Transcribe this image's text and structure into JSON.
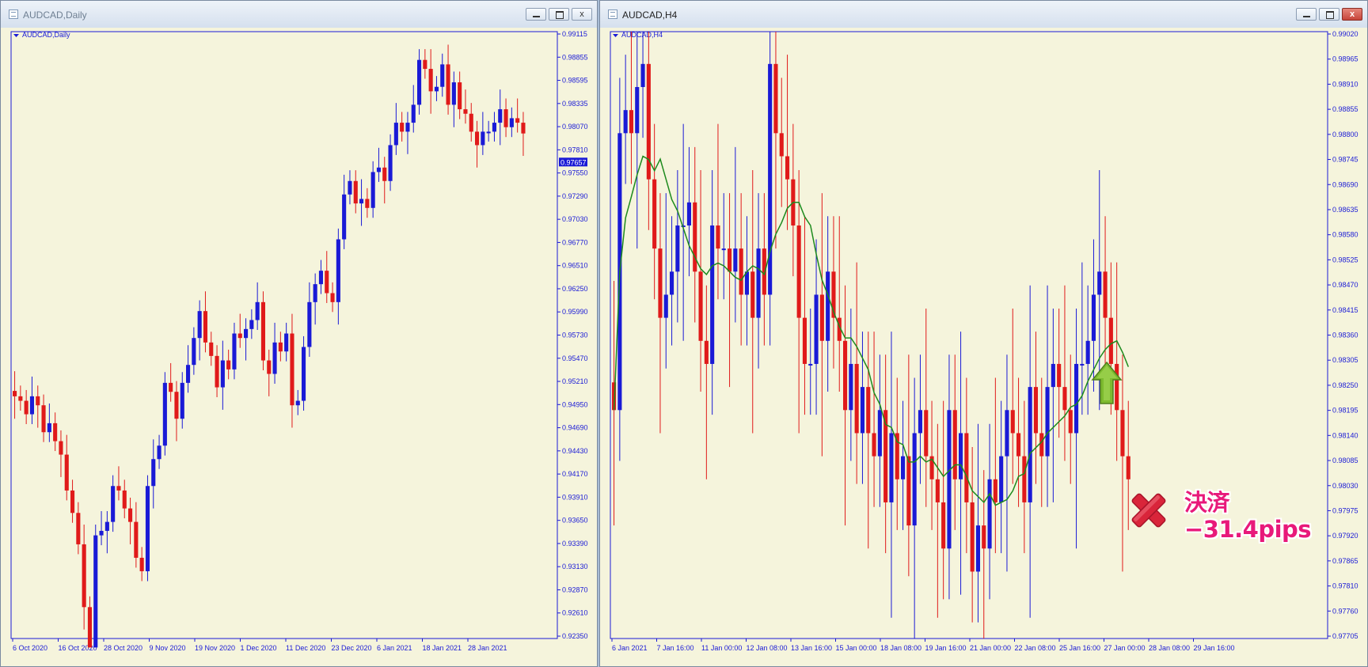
{
  "windows": [
    {
      "title": "AUDCAD,Daily",
      "label": "AUDCAD,Daily",
      "price_marker": "0.97657",
      "ylim": [
        0.9235,
        0.99115
      ],
      "y_ticks": [
        "0.99115",
        "0.98855",
        "0.98595",
        "0.98335",
        "0.98070",
        "0.97810",
        "0.97550",
        "0.97290",
        "0.97030",
        "0.96770",
        "0.96510",
        "0.96250",
        "0.95990",
        "0.95730",
        "0.95470",
        "0.95210",
        "0.94950",
        "0.94690",
        "0.94430",
        "0.94170",
        "0.93910",
        "0.93650",
        "0.93390",
        "0.93130",
        "0.92870",
        "0.92610",
        "0.92350"
      ],
      "x_ticks": [
        "6 Oct 2020",
        "16 Oct 2020",
        "28 Oct 2020",
        "9 Nov 2020",
        "19 Nov 2020",
        "1 Dec 2020",
        "11 Dec 2020",
        "23 Dec 2020",
        "6 Jan 2021",
        "18 Jan 2021",
        "28 Jan 2021"
      ],
      "close_button": "x"
    },
    {
      "title": "AUDCAD,H4",
      "label": "AUDCAD,H4",
      "ylim": [
        0.97705,
        0.9902
      ],
      "y_ticks": [
        "0.99020",
        "0.98965",
        "0.98910",
        "0.98855",
        "0.98800",
        "0.98745",
        "0.98690",
        "0.98635",
        "0.98580",
        "0.98525",
        "0.98470",
        "0.98415",
        "0.98360",
        "0.98305",
        "0.98250",
        "0.98195",
        "0.98140",
        "0.98085",
        "0.98030",
        "0.97975",
        "0.97920",
        "0.97865",
        "0.97810",
        "0.97760",
        "0.97705"
      ],
      "x_ticks": [
        "6 Jan 2021",
        "7 Jan 16:00",
        "11 Jan 00:00",
        "12 Jan 08:00",
        "13 Jan 16:00",
        "15 Jan 00:00",
        "18 Jan 08:00",
        "19 Jan 16:00",
        "21 Jan 00:00",
        "22 Jan 08:00",
        "25 Jan 16:00",
        "27 Jan 00:00",
        "28 Jan 08:00",
        "29 Jan 16:00"
      ],
      "close_button": "x"
    }
  ],
  "chart_data": [
    {
      "type": "candlestick",
      "title": "AUDCAD,Daily",
      "colors": {
        "bull": "#1a1ad6",
        "bear": "#e01a1a",
        "background": "#f5f4dc",
        "axis": "#1a1ad6"
      },
      "close": [
        0.9505,
        0.95,
        0.9485,
        0.9505,
        0.9495,
        0.9465,
        0.9475,
        0.9455,
        0.944,
        0.94,
        0.9375,
        0.934,
        0.927,
        0.9225,
        0.935,
        0.9355,
        0.9365,
        0.9405,
        0.94,
        0.938,
        0.9365,
        0.9325,
        0.931,
        0.9405,
        0.9435,
        0.945,
        0.952,
        0.951,
        0.948,
        0.952,
        0.954,
        0.957,
        0.96,
        0.9565,
        0.955,
        0.9515,
        0.9545,
        0.9535,
        0.9575,
        0.957,
        0.958,
        0.959,
        0.961,
        0.9545,
        0.953,
        0.9565,
        0.9555,
        0.9575,
        0.9495,
        0.95,
        0.956,
        0.961,
        0.963,
        0.9645,
        0.962,
        0.961,
        0.968,
        0.973,
        0.9745,
        0.972,
        0.9725,
        0.9715,
        0.9755,
        0.976,
        0.9745,
        0.9785,
        0.981,
        0.98,
        0.981,
        0.983,
        0.988,
        0.987,
        0.9845,
        0.985,
        0.9875,
        0.983,
        0.9855,
        0.9825,
        0.982,
        0.98,
        0.9785,
        0.98,
        0.98,
        0.981,
        0.9825,
        0.9805,
        0.9815,
        0.981,
        0.9798
      ],
      "x_categories_count": 89,
      "ylim": [
        0.9235,
        0.99115
      ]
    },
    {
      "type": "candlestick",
      "title": "AUDCAD,H4",
      "series": [
        {
          "name": "MA",
          "color": "#1d8a1d"
        }
      ],
      "close": [
        0.982,
        0.988,
        0.9885,
        0.988,
        0.989,
        0.9895,
        0.987,
        0.9855,
        0.984,
        0.9845,
        0.985,
        0.986,
        0.986,
        0.9865,
        0.985,
        0.9835,
        0.983,
        0.986,
        0.9855,
        0.9855,
        0.985,
        0.9855,
        0.9845,
        0.985,
        0.984,
        0.9855,
        0.9845,
        0.9895,
        0.988,
        0.9875,
        0.987,
        0.986,
        0.984,
        0.983,
        0.983,
        0.9845,
        0.9835,
        0.985,
        0.984,
        0.9835,
        0.982,
        0.983,
        0.9815,
        0.9825,
        0.9815,
        0.981,
        0.982,
        0.98,
        0.9815,
        0.9805,
        0.981,
        0.9795,
        0.9815,
        0.982,
        0.981,
        0.9805,
        0.98,
        0.979,
        0.982,
        0.9805,
        0.9815,
        0.98,
        0.9785,
        0.9795,
        0.979,
        0.9805,
        0.98,
        0.981,
        0.982,
        0.9815,
        0.981,
        0.98,
        0.9825,
        0.9815,
        0.981,
        0.9825,
        0.983,
        0.9825,
        0.982,
        0.9815,
        0.983,
        0.983,
        0.9835,
        0.9845,
        0.985,
        0.984,
        0.983,
        0.982,
        0.981,
        0.9805
      ],
      "ylim": [
        0.97705,
        0.9902
      ]
    }
  ],
  "annotation": {
    "line1": "決済",
    "line2": "−31.4pips",
    "color": "#e8197a",
    "arrow_color": "#7dbb2f"
  }
}
